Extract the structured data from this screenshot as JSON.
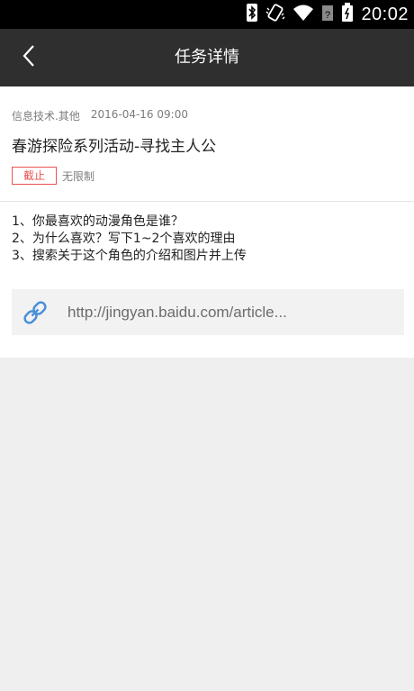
{
  "status_bar": {
    "time": "20:02",
    "icons": [
      "bluetooth-icon",
      "vibrate-icon",
      "wifi-icon",
      "signal-icon",
      "battery-icon"
    ]
  },
  "header": {
    "title": "任务详情",
    "back_icon": "chevron-left-icon"
  },
  "task": {
    "category": "信息技术.其他",
    "datetime": "2016-04-16 09:00",
    "title": "春游探险系列活动-寻找主人公",
    "status": "截止",
    "limit": "无限制",
    "questions": [
      "1、你最喜欢的动漫角色是谁？",
      "2、为什么喜欢？写下1~2个喜欢的理由",
      "3、搜索关于这个角色的介绍和图片并上传"
    ],
    "link": {
      "icon": "link-icon",
      "text": "http://jingyan.baidu.com/article..."
    }
  },
  "colors": {
    "status_bar": "#000000",
    "nav_bar": "#2f2f2f",
    "accent_red": "#e85252",
    "link_icon": "#4a90d9",
    "background": "#efefef"
  }
}
